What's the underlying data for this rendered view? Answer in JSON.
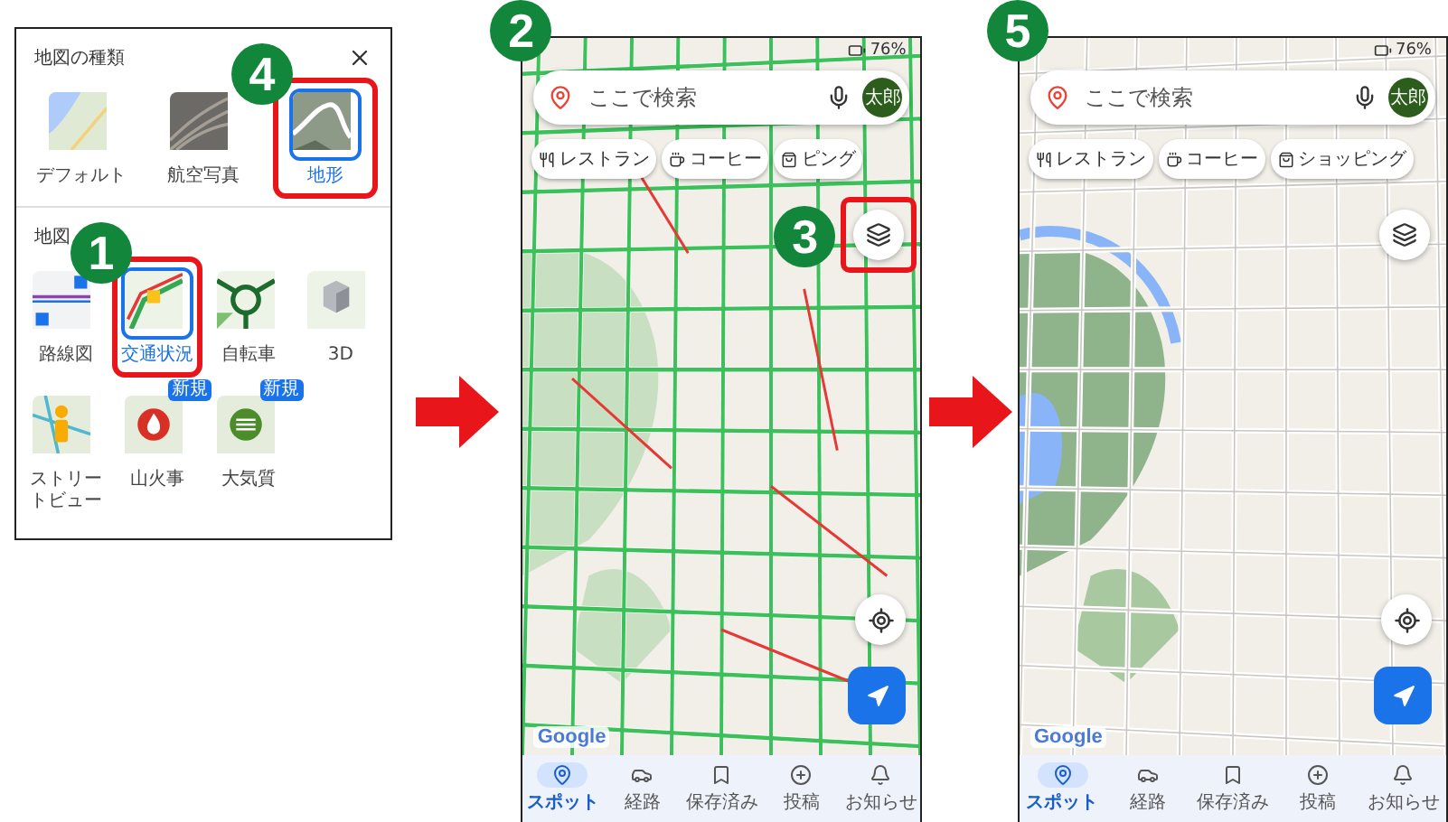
{
  "panel": {
    "title": "地図の種類",
    "map_types": [
      {
        "kind": "default",
        "label": "デフォルト",
        "selected": false,
        "highlighted": false
      },
      {
        "kind": "satellite",
        "label": "航空写真",
        "selected": false,
        "highlighted": false
      },
      {
        "kind": "terrain",
        "label": "地形",
        "selected": true,
        "highlighted": true,
        "step": "4"
      }
    ],
    "details_title": "地図",
    "details": [
      {
        "kind": "transit",
        "label": "路線図",
        "selected": false,
        "highlighted": false
      },
      {
        "kind": "traffic",
        "label": "交通状況",
        "selected": true,
        "highlighted": true,
        "step": "1"
      },
      {
        "kind": "bike",
        "label": "自転車",
        "selected": false,
        "highlighted": false
      },
      {
        "kind": "cube",
        "label": "3D",
        "selected": false,
        "highlighted": false
      },
      {
        "kind": "streetview",
        "label": "ストリートビュー",
        "selected": false,
        "highlighted": false
      },
      {
        "kind": "wildfire",
        "label": "山火事",
        "selected": false,
        "highlighted": false,
        "tag": "新規"
      },
      {
        "kind": "air",
        "label": "大気質",
        "selected": false,
        "highlighted": false,
        "tag": "新規"
      }
    ]
  },
  "phones": [
    {
      "step": "2",
      "traffic": true,
      "terrain": false,
      "battery": "76%",
      "search": {
        "placeholder": "ここで検索"
      },
      "avatar": "太郎",
      "chips": [
        {
          "kind": "restaurant",
          "label": "レストラン"
        },
        {
          "kind": "coffee",
          "label": "コーヒー"
        },
        {
          "kind": "shopping",
          "label": "ピング"
        }
      ],
      "layers": {
        "highlighted": true,
        "step": "3"
      },
      "logo": "Google",
      "nav": [
        {
          "label": "スポット",
          "selected": true
        },
        {
          "label": "経路",
          "selected": false
        },
        {
          "label": "保存済み",
          "selected": false
        },
        {
          "label": "投稿",
          "selected": false
        },
        {
          "label": "お知らせ",
          "selected": false
        }
      ]
    },
    {
      "step": "5",
      "traffic": false,
      "terrain": true,
      "battery": "76%",
      "search": {
        "placeholder": "ここで検索"
      },
      "avatar": "太郎",
      "chips": [
        {
          "kind": "restaurant",
          "label": "レストラン"
        },
        {
          "kind": "coffee",
          "label": "コーヒー"
        },
        {
          "kind": "shopping",
          "label": "ショッピング"
        }
      ],
      "layers": {
        "highlighted": false
      },
      "logo": "Google",
      "nav": [
        {
          "label": "スポット",
          "selected": true
        },
        {
          "label": "経路",
          "selected": false
        },
        {
          "label": "保存済み",
          "selected": false
        },
        {
          "label": "投稿",
          "selected": false
        },
        {
          "label": "お知らせ",
          "selected": false
        }
      ]
    }
  ]
}
